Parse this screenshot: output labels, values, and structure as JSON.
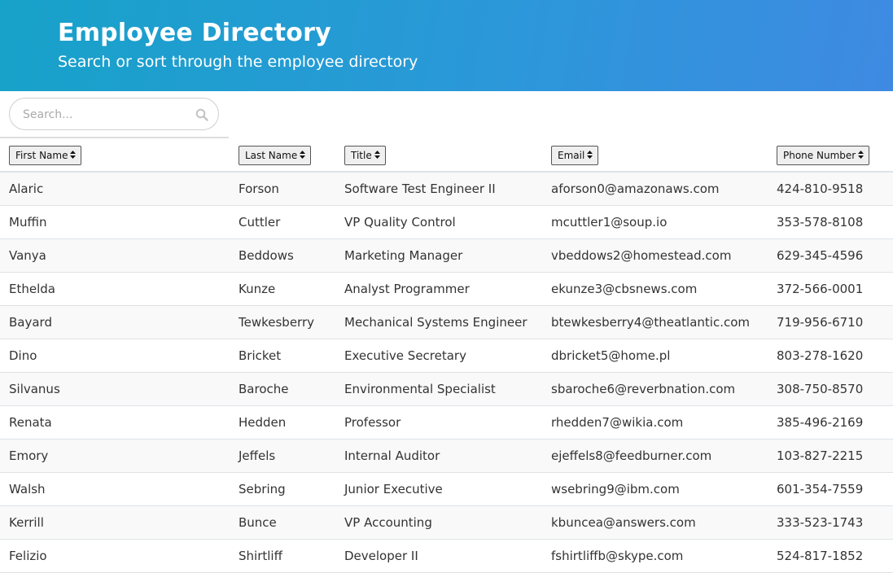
{
  "header": {
    "title": "Employee Directory",
    "subtitle": "Search or sort through the employee directory"
  },
  "search": {
    "placeholder": "Search...",
    "value": "",
    "icon": "search-icon"
  },
  "columns": [
    {
      "label": "First Name",
      "icon": "sort-icon"
    },
    {
      "label": "Last Name",
      "icon": "sort-icon"
    },
    {
      "label": "Title",
      "icon": "sort-icon"
    },
    {
      "label": "Email",
      "icon": "sort-icon"
    },
    {
      "label": "Phone Number",
      "icon": "sort-icon"
    }
  ],
  "employees": [
    {
      "first": "Alaric",
      "last": "Forson",
      "title": "Software Test Engineer II",
      "email": "aforson0@amazonaws.com",
      "phone": "424-810-9518"
    },
    {
      "first": "Muffin",
      "last": "Cuttler",
      "title": "VP Quality Control",
      "email": "mcuttler1@soup.io",
      "phone": "353-578-8108"
    },
    {
      "first": "Vanya",
      "last": "Beddows",
      "title": "Marketing Manager",
      "email": "vbeddows2@homestead.com",
      "phone": "629-345-4596"
    },
    {
      "first": "Ethelda",
      "last": "Kunze",
      "title": "Analyst Programmer",
      "email": "ekunze3@cbsnews.com",
      "phone": "372-566-0001"
    },
    {
      "first": "Bayard",
      "last": "Tewkesberry",
      "title": "Mechanical Systems Engineer",
      "email": "btewkesberry4@theatlantic.com",
      "phone": "719-956-6710"
    },
    {
      "first": "Dino",
      "last": "Bricket",
      "title": "Executive Secretary",
      "email": "dbricket5@home.pl",
      "phone": "803-278-1620"
    },
    {
      "first": "Silvanus",
      "last": "Baroche",
      "title": "Environmental Specialist",
      "email": "sbaroche6@reverbnation.com",
      "phone": "308-750-8570"
    },
    {
      "first": "Renata",
      "last": "Hedden",
      "title": "Professor",
      "email": "rhedden7@wikia.com",
      "phone": "385-496-2169"
    },
    {
      "first": "Emory",
      "last": "Jeffels",
      "title": "Internal Auditor",
      "email": "ejeffels8@feedburner.com",
      "phone": "103-827-2215"
    },
    {
      "first": "Walsh",
      "last": "Sebring",
      "title": "Junior Executive",
      "email": "wsebring9@ibm.com",
      "phone": "601-354-7559"
    },
    {
      "first": "Kerrill",
      "last": "Bunce",
      "title": "VP Accounting",
      "email": "kbuncea@answers.com",
      "phone": "333-523-1743"
    },
    {
      "first": "Felizio",
      "last": "Shirtliff",
      "title": "Developer II",
      "email": "fshirtliffb@skype.com",
      "phone": "524-817-1852"
    }
  ]
}
